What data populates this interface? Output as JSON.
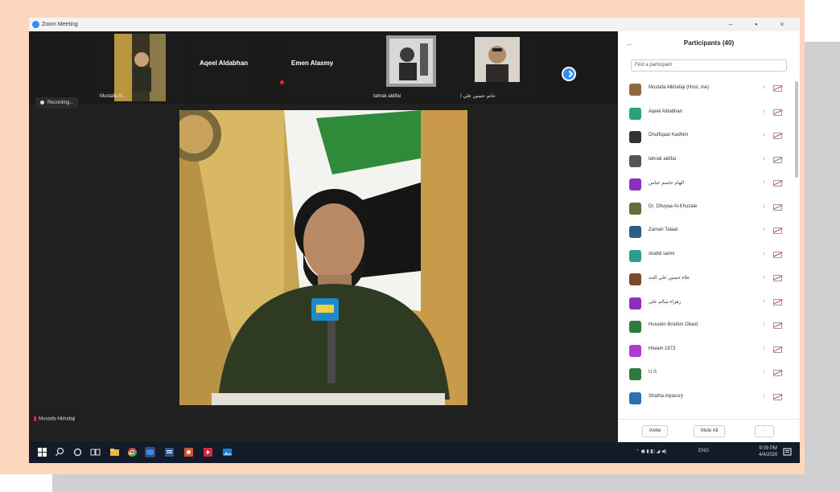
{
  "window": {
    "title": "Zoom Meeting"
  },
  "gallery": {
    "tiles": [
      {
        "name": "Mustafa Al..."
      },
      {
        "name": "Aqeel Aldabhan"
      },
      {
        "name": "Emen Alasmy"
      },
      {
        "name": "tahrak aldifai"
      },
      {
        "name": "حاتم حسين علي ا"
      }
    ]
  },
  "recording_label": "Recording...",
  "speaker": {
    "name": "Mustafa Alkhafaji"
  },
  "participants": {
    "title": "Participants (40)",
    "search_placeholder": "Find a participant",
    "items": [
      {
        "name": "Mustafa Alkhafaji (Host, me)",
        "color": "#8b6a3e"
      },
      {
        "name": "Aqeel Aldabhan",
        "color": "#27a27a"
      },
      {
        "name": "Dhulfiqaar Kadhim",
        "color": "#333333"
      },
      {
        "name": "tahrak aldifai",
        "color": "#555555"
      },
      {
        "name": "الهام جاسم عباس",
        "color": "#8a2fbf"
      },
      {
        "name": "Dr. Dhuyaa Al-Khuzaie",
        "color": "#6b6b3a"
      },
      {
        "name": "Zaman Talaat",
        "color": "#2b5c8a"
      },
      {
        "name": "shahd samir",
        "color": "#2a9d8f"
      },
      {
        "name": "علاء حسين علي الحد",
        "color": "#7a4a2a"
      },
      {
        "name": "زهراء سالم علي",
        "color": "#8a2fbf"
      },
      {
        "name": "Hussein Ibrahim Obaid",
        "color": "#2f7a3e"
      },
      {
        "name": "Hiwam 1973",
        "color": "#b03ad0"
      },
      {
        "name": "U S",
        "color": "#2f7a3e"
      },
      {
        "name": "Shatha Alyassry",
        "color": "#2d6fb0"
      }
    ],
    "invite_label": "Invite",
    "mute_all_label": "Mute All"
  },
  "taskbar": {
    "language": "ENG",
    "time": "9:09 PM",
    "date": "4/4/2020"
  }
}
